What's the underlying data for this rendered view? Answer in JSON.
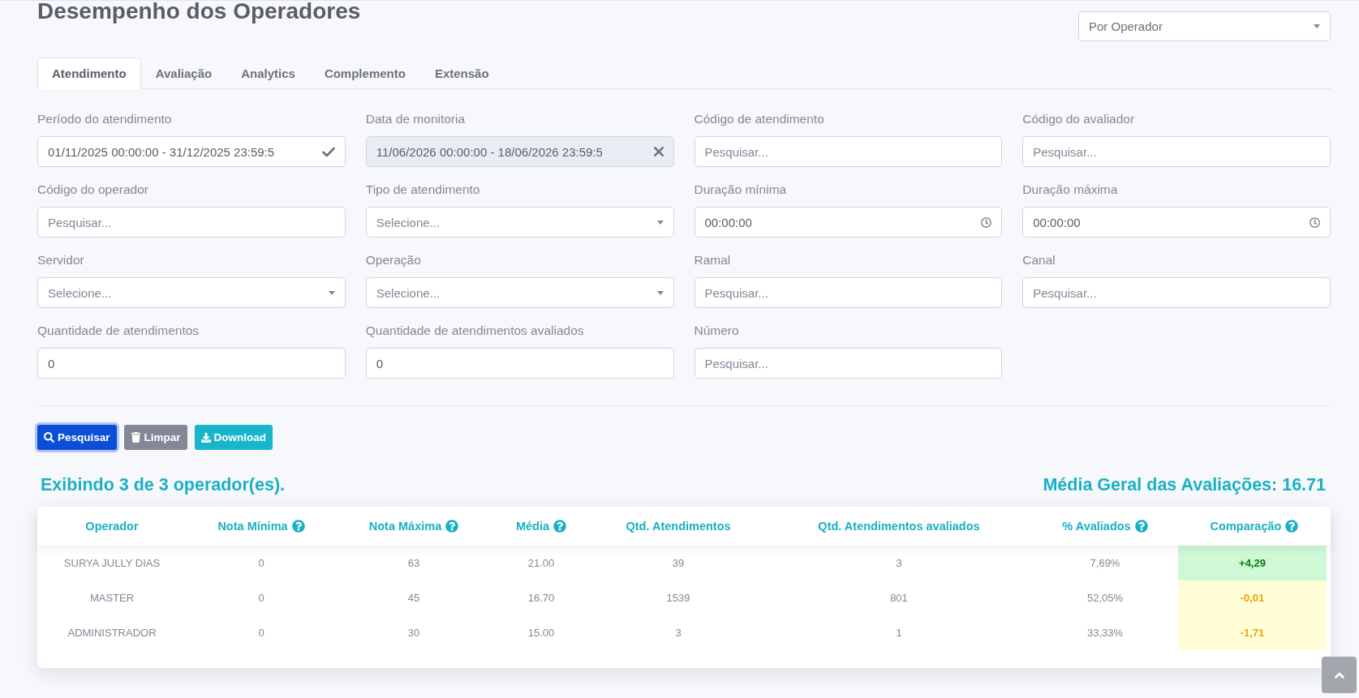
{
  "page": {
    "title": "Desempenho dos Operadores"
  },
  "view_select": {
    "value": "Por Operador"
  },
  "tabs": [
    {
      "label": "Atendimento",
      "selected": true
    },
    {
      "label": "Avaliação",
      "selected": false
    },
    {
      "label": "Analytics",
      "selected": false
    },
    {
      "label": "Complemento",
      "selected": false
    },
    {
      "label": "Extensão",
      "selected": false
    }
  ],
  "filters": [
    {
      "label": "Período do atendimento",
      "kind": "date-range",
      "value": "01/11/2025 00:00:00 - 31/12/2025 23:59:5",
      "disabled": false
    },
    {
      "label": "Data de monitoria",
      "kind": "date-range",
      "value": "11/06/2026 00:00:00 - 18/06/2026 23:59:5",
      "disabled": true
    },
    {
      "label": "Código de atendimento",
      "kind": "text",
      "placeholder": "Pesquisar...",
      "disabled": false
    },
    {
      "label": "Código do avaliador",
      "kind": "text",
      "placeholder": "Pesquisar...",
      "disabled": false
    },
    {
      "label": "Código do operador",
      "kind": "text",
      "placeholder": "Pesquisar...",
      "disabled": false
    },
    {
      "label": "Tipo de atendimento",
      "kind": "select",
      "placeholder": "Selecione...",
      "disabled": false
    },
    {
      "label": "Duração mínima",
      "kind": "time",
      "value": "00:00:00",
      "disabled": false
    },
    {
      "label": "Duração máxima",
      "kind": "time",
      "value": "00:00:00",
      "disabled": false
    },
    {
      "label": "Servidor",
      "kind": "select",
      "placeholder": "Selecione...",
      "disabled": false
    },
    {
      "label": "Operação",
      "kind": "select",
      "placeholder": "Selecione...",
      "disabled": false
    },
    {
      "label": "Ramal",
      "kind": "text",
      "placeholder": "Pesquisar...",
      "disabled": false
    },
    {
      "label": "Canal",
      "kind": "text",
      "placeholder": "Pesquisar...",
      "disabled": false
    },
    {
      "label": "Quantidade de atendimentos",
      "kind": "number",
      "value": "0",
      "disabled": false
    },
    {
      "label": "Quantidade de atendimentos avaliados",
      "kind": "number",
      "value": "0",
      "disabled": false
    },
    {
      "label": "Número",
      "kind": "text",
      "placeholder": "Pesquisar...",
      "disabled": false
    }
  ],
  "buttons": [
    {
      "label": "Pesquisar",
      "kind": "search",
      "focused": true
    },
    {
      "label": "Limpar",
      "kind": "clear",
      "focused": false
    },
    {
      "label": "Download",
      "kind": "download",
      "focused": false
    }
  ],
  "results": {
    "summary": "Exibindo 3 de 3 operador(es).",
    "average": "Média Geral das Avaliações: 16.71"
  },
  "table": {
    "columns": [
      {
        "label": "Operador",
        "help": false
      },
      {
        "label": "Nota Mínima",
        "help": true
      },
      {
        "label": "Nota Máxima",
        "help": true
      },
      {
        "label": "Média",
        "help": true
      },
      {
        "label": "Qtd. Atendimentos",
        "help": false
      },
      {
        "label": "Qtd. Atendimentos avaliados",
        "help": false
      },
      {
        "label": "% Avaliados",
        "help": true
      },
      {
        "label": "Comparação",
        "help": true
      }
    ],
    "rows": [
      {
        "cells": [
          "SURYA JULLY DIAS",
          "0",
          "63",
          "21.00",
          "39",
          "3",
          "7,69%"
        ],
        "comparison": {
          "value": "+4,29",
          "above_average": true
        }
      },
      {
        "cells": [
          "MASTER",
          "0",
          "45",
          "16.70",
          "1539",
          "801",
          "52,05%"
        ],
        "comparison": {
          "value": "-0,01",
          "above_average": false
        }
      },
      {
        "cells": [
          "ADMINISTRADOR",
          "0",
          "30",
          "15.00",
          "3",
          "1",
          "33,33%"
        ],
        "comparison": {
          "value": "-1,71",
          "above_average": false
        }
      }
    ]
  }
}
